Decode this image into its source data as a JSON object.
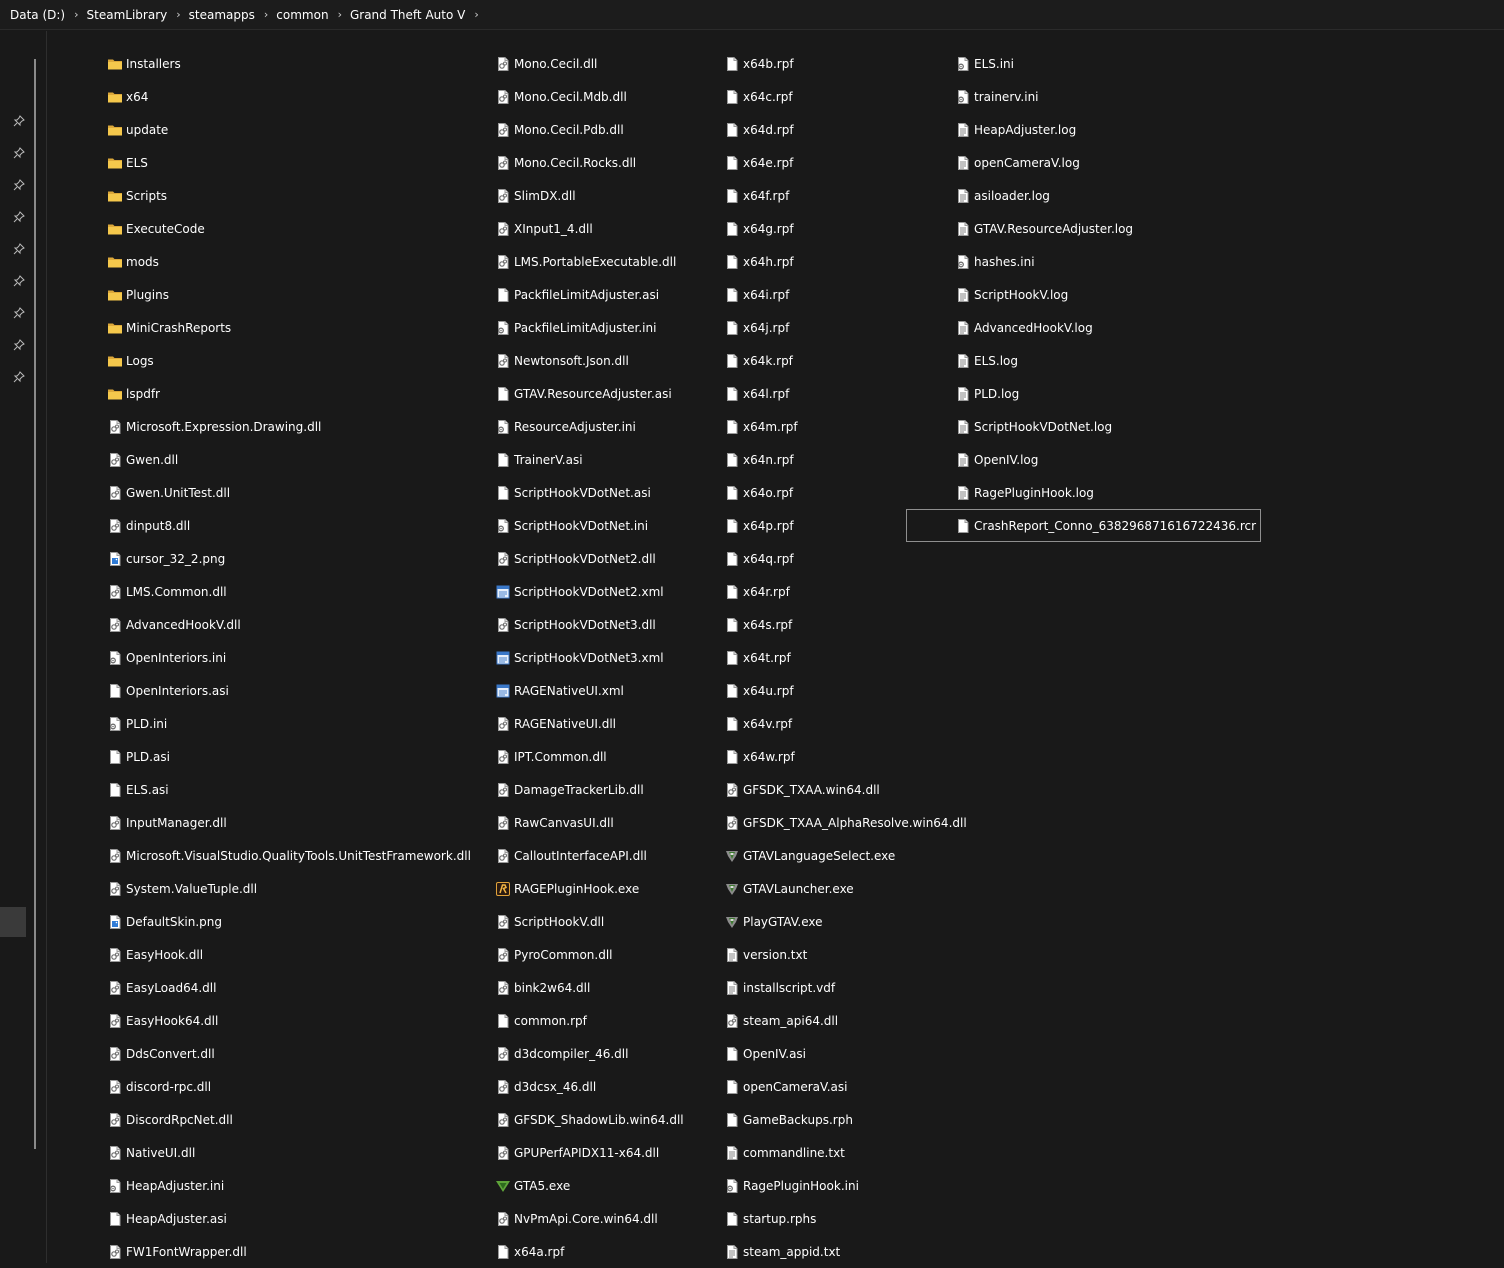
{
  "breadcrumb": [
    "Data (D:)",
    "SteamLibrary",
    "steamapps",
    "common",
    "Grand Theft Auto V"
  ],
  "breadcrumb_separator": "›",
  "nav": {
    "pin_icon": "📌",
    "pin_count": 9
  },
  "colors": {
    "background": "#191919",
    "text": "#ffffff",
    "folder": "#f5c84c",
    "selection_border": "#8f8f8f"
  },
  "columns": [
    [
      {
        "name": "Installers",
        "icon": "folder"
      },
      {
        "name": "x64",
        "icon": "folder"
      },
      {
        "name": "update",
        "icon": "folder"
      },
      {
        "name": "ELS",
        "icon": "folder"
      },
      {
        "name": "Scripts",
        "icon": "folder"
      },
      {
        "name": "ExecuteCode",
        "icon": "folder"
      },
      {
        "name": "mods",
        "icon": "folder"
      },
      {
        "name": "Plugins",
        "icon": "folder"
      },
      {
        "name": "MiniCrashReports",
        "icon": "folder"
      },
      {
        "name": "Logs",
        "icon": "folder"
      },
      {
        "name": "lspdfr",
        "icon": "folder"
      },
      {
        "name": "Microsoft.Expression.Drawing.dll",
        "icon": "dll"
      },
      {
        "name": "Gwen.dll",
        "icon": "dll"
      },
      {
        "name": "Gwen.UnitTest.dll",
        "icon": "dll"
      },
      {
        "name": "dinput8.dll",
        "icon": "dll"
      },
      {
        "name": "cursor_32_2.png",
        "icon": "image"
      },
      {
        "name": "LMS.Common.dll",
        "icon": "dll"
      },
      {
        "name": "AdvancedHookV.dll",
        "icon": "dll"
      },
      {
        "name": "OpenInteriors.ini",
        "icon": "ini"
      },
      {
        "name": "OpenInteriors.asi",
        "icon": "file"
      },
      {
        "name": "PLD.ini",
        "icon": "ini"
      },
      {
        "name": "PLD.asi",
        "icon": "file"
      },
      {
        "name": "ELS.asi",
        "icon": "file"
      },
      {
        "name": "InputManager.dll",
        "icon": "dll"
      },
      {
        "name": "Microsoft.VisualStudio.QualityTools.UnitTestFramework.dll",
        "icon": "dll"
      },
      {
        "name": "System.ValueTuple.dll",
        "icon": "dll"
      },
      {
        "name": "DefaultSkin.png",
        "icon": "image"
      },
      {
        "name": "EasyHook.dll",
        "icon": "dll"
      },
      {
        "name": "EasyLoad64.dll",
        "icon": "dll"
      },
      {
        "name": "EasyHook64.dll",
        "icon": "dll"
      },
      {
        "name": "DdsConvert.dll",
        "icon": "dll"
      },
      {
        "name": "discord-rpc.dll",
        "icon": "dll"
      },
      {
        "name": "DiscordRpcNet.dll",
        "icon": "dll"
      },
      {
        "name": "NativeUI.dll",
        "icon": "dll"
      },
      {
        "name": "HeapAdjuster.ini",
        "icon": "ini"
      },
      {
        "name": "HeapAdjuster.asi",
        "icon": "file"
      },
      {
        "name": "FW1FontWrapper.dll",
        "icon": "dll"
      }
    ],
    [
      {
        "name": "Mono.Cecil.dll",
        "icon": "dll"
      },
      {
        "name": "Mono.Cecil.Mdb.dll",
        "icon": "dll"
      },
      {
        "name": "Mono.Cecil.Pdb.dll",
        "icon": "dll"
      },
      {
        "name": "Mono.Cecil.Rocks.dll",
        "icon": "dll"
      },
      {
        "name": "SlimDX.dll",
        "icon": "dll"
      },
      {
        "name": "XInput1_4.dll",
        "icon": "dll"
      },
      {
        "name": "LMS.PortableExecutable.dll",
        "icon": "dll"
      },
      {
        "name": "PackfileLimitAdjuster.asi",
        "icon": "file"
      },
      {
        "name": "PackfileLimitAdjuster.ini",
        "icon": "ini"
      },
      {
        "name": "Newtonsoft.Json.dll",
        "icon": "dll"
      },
      {
        "name": "GTAV.ResourceAdjuster.asi",
        "icon": "file"
      },
      {
        "name": "ResourceAdjuster.ini",
        "icon": "ini"
      },
      {
        "name": "TrainerV.asi",
        "icon": "file"
      },
      {
        "name": "ScriptHookVDotNet.asi",
        "icon": "file"
      },
      {
        "name": "ScriptHookVDotNet.ini",
        "icon": "ini"
      },
      {
        "name": "ScriptHookVDotNet2.dll",
        "icon": "dll"
      },
      {
        "name": "ScriptHookVDotNet2.xml",
        "icon": "xml"
      },
      {
        "name": "ScriptHookVDotNet3.dll",
        "icon": "dll"
      },
      {
        "name": "ScriptHookVDotNet3.xml",
        "icon": "xml"
      },
      {
        "name": "RAGENativeUI.xml",
        "icon": "xml"
      },
      {
        "name": "RAGENativeUI.dll",
        "icon": "dll"
      },
      {
        "name": "IPT.Common.dll",
        "icon": "dll"
      },
      {
        "name": "DamageTrackerLib.dll",
        "icon": "dll"
      },
      {
        "name": "RawCanvasUI.dll",
        "icon": "dll"
      },
      {
        "name": "CalloutInterfaceAPI.dll",
        "icon": "dll"
      },
      {
        "name": "RAGEPluginHook.exe",
        "icon": "rph-exe"
      },
      {
        "name": "ScriptHookV.dll",
        "icon": "dll"
      },
      {
        "name": "PyroCommon.dll",
        "icon": "dll"
      },
      {
        "name": "bink2w64.dll",
        "icon": "dll"
      },
      {
        "name": "common.rpf",
        "icon": "file"
      },
      {
        "name": "d3dcompiler_46.dll",
        "icon": "dll"
      },
      {
        "name": "d3dcsx_46.dll",
        "icon": "dll"
      },
      {
        "name": "GFSDK_ShadowLib.win64.dll",
        "icon": "dll"
      },
      {
        "name": "GPUPerfAPIDX11-x64.dll",
        "icon": "dll"
      },
      {
        "name": "GTA5.exe",
        "icon": "gta-exe"
      },
      {
        "name": "NvPmApi.Core.win64.dll",
        "icon": "dll"
      },
      {
        "name": "x64a.rpf",
        "icon": "file"
      }
    ],
    [
      {
        "name": "x64b.rpf",
        "icon": "file"
      },
      {
        "name": "x64c.rpf",
        "icon": "file"
      },
      {
        "name": "x64d.rpf",
        "icon": "file"
      },
      {
        "name": "x64e.rpf",
        "icon": "file"
      },
      {
        "name": "x64f.rpf",
        "icon": "file"
      },
      {
        "name": "x64g.rpf",
        "icon": "file"
      },
      {
        "name": "x64h.rpf",
        "icon": "file"
      },
      {
        "name": "x64i.rpf",
        "icon": "file"
      },
      {
        "name": "x64j.rpf",
        "icon": "file"
      },
      {
        "name": "x64k.rpf",
        "icon": "file"
      },
      {
        "name": "x64l.rpf",
        "icon": "file"
      },
      {
        "name": "x64m.rpf",
        "icon": "file"
      },
      {
        "name": "x64n.rpf",
        "icon": "file"
      },
      {
        "name": "x64o.rpf",
        "icon": "file"
      },
      {
        "name": "x64p.rpf",
        "icon": "file"
      },
      {
        "name": "x64q.rpf",
        "icon": "file"
      },
      {
        "name": "x64r.rpf",
        "icon": "file"
      },
      {
        "name": "x64s.rpf",
        "icon": "file"
      },
      {
        "name": "x64t.rpf",
        "icon": "file"
      },
      {
        "name": "x64u.rpf",
        "icon": "file"
      },
      {
        "name": "x64v.rpf",
        "icon": "file"
      },
      {
        "name": "x64w.rpf",
        "icon": "file"
      },
      {
        "name": "GFSDK_TXAA.win64.dll",
        "icon": "dll"
      },
      {
        "name": "GFSDK_TXAA_AlphaResolve.win64.dll",
        "icon": "dll"
      },
      {
        "name": "GTAVLanguageSelect.exe",
        "icon": "gtav-exe"
      },
      {
        "name": "GTAVLauncher.exe",
        "icon": "gtav-exe"
      },
      {
        "name": "PlayGTAV.exe",
        "icon": "gtav-exe"
      },
      {
        "name": "version.txt",
        "icon": "text"
      },
      {
        "name": "installscript.vdf",
        "icon": "text"
      },
      {
        "name": "steam_api64.dll",
        "icon": "dll"
      },
      {
        "name": "OpenIV.asi",
        "icon": "file"
      },
      {
        "name": "openCameraV.asi",
        "icon": "file"
      },
      {
        "name": "GameBackups.rph",
        "icon": "file"
      },
      {
        "name": "commandline.txt",
        "icon": "text"
      },
      {
        "name": "RagePluginHook.ini",
        "icon": "ini"
      },
      {
        "name": "startup.rphs",
        "icon": "file"
      },
      {
        "name": "steam_appid.txt",
        "icon": "text"
      }
    ],
    [
      {
        "name": "ELS.ini",
        "icon": "ini"
      },
      {
        "name": "trainerv.ini",
        "icon": "ini"
      },
      {
        "name": "HeapAdjuster.log",
        "icon": "text"
      },
      {
        "name": "openCameraV.log",
        "icon": "text"
      },
      {
        "name": "asiloader.log",
        "icon": "text"
      },
      {
        "name": "GTAV.ResourceAdjuster.log",
        "icon": "text"
      },
      {
        "name": "hashes.ini",
        "icon": "ini"
      },
      {
        "name": "ScriptHookV.log",
        "icon": "text"
      },
      {
        "name": "AdvancedHookV.log",
        "icon": "text"
      },
      {
        "name": "ELS.log",
        "icon": "text"
      },
      {
        "name": "PLD.log",
        "icon": "text"
      },
      {
        "name": "ScriptHookVDotNet.log",
        "icon": "text"
      },
      {
        "name": "OpenIV.log",
        "icon": "text"
      },
      {
        "name": "RagePluginHook.log",
        "icon": "text"
      },
      {
        "name": "CrashReport_Conno_638296871616722436.rcr",
        "icon": "file",
        "selected": true
      }
    ]
  ]
}
